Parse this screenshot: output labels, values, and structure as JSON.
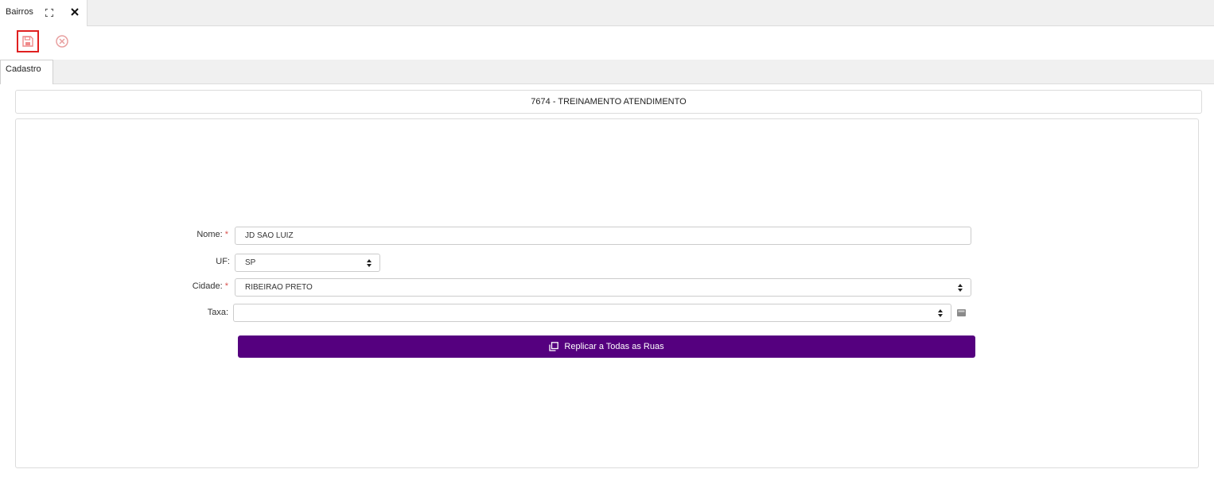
{
  "window": {
    "tab_title": "Bairros",
    "expand_icon": "expand-icon",
    "close_icon": "close-icon"
  },
  "toolbar": {
    "save_icon": "save-icon",
    "cancel_icon": "cancel-icon"
  },
  "subtabs": [
    {
      "label": "Cadastro"
    }
  ],
  "org_bar": {
    "text": "7674 - TREINAMENTO ATENDIMENTO"
  },
  "form": {
    "nome": {
      "label": "Nome:",
      "required": "*",
      "value": "JD SAO LUIZ"
    },
    "uf": {
      "label": "UF:",
      "value": "SP"
    },
    "cidade": {
      "label": "Cidade:",
      "required": "*",
      "value": "RIBEIRAO PRETO"
    },
    "taxa": {
      "label": "Taxa:",
      "value": ""
    },
    "calculator_icon": "calculator-icon",
    "replicar_button": {
      "label": "Replicar a Todas as Ruas",
      "icon": "copy-icon"
    }
  },
  "colors": {
    "accent": "#55007f",
    "required": "#d9534f",
    "save_highlight": "#e02020",
    "cancel": "#e8a0a0"
  }
}
